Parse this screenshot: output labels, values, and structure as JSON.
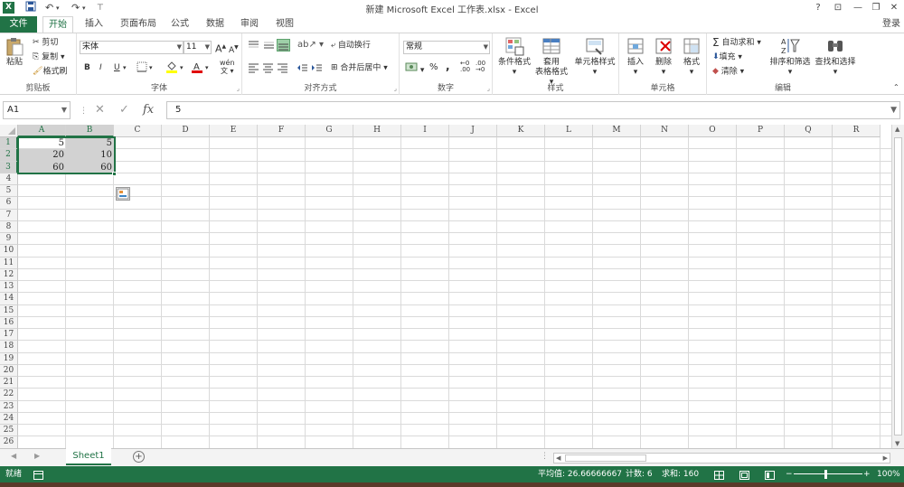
{
  "window": {
    "title": "新建 Microsoft Excel 工作表.xlsx - Excel",
    "help": "?",
    "restore_ribbon": "⊡",
    "minimize": "—",
    "maximize": "❐",
    "close": "✕"
  },
  "qat": {
    "undo": "↶",
    "redo": "↷",
    "more": "⊤"
  },
  "tabs": [
    {
      "label": "文件"
    },
    {
      "label": "开始"
    },
    {
      "label": "插入"
    },
    {
      "label": "页面布局"
    },
    {
      "label": "公式"
    },
    {
      "label": "数据"
    },
    {
      "label": "审阅"
    },
    {
      "label": "视图"
    }
  ],
  "login": "登录",
  "ribbon": {
    "clipboard": {
      "paste": "粘贴",
      "cut": "剪切",
      "copy": "复制",
      "format_painter": "格式刷",
      "label": "剪贴板"
    },
    "font": {
      "name": "宋体",
      "size": "11",
      "grow": "A",
      "shrink": "A",
      "bold": "B",
      "italic": "I",
      "underline": "U",
      "label": "字体",
      "phonetic": "wén"
    },
    "alignment": {
      "wrap": "自动换行",
      "merge": "合并后居中",
      "label": "对齐方式"
    },
    "number": {
      "format": "常规",
      "percent": "%",
      "comma": ",",
      "label": "数字"
    },
    "styles": {
      "conditional": "条件格式",
      "table_line1": "套用",
      "table_line2": "表格格式",
      "cell_styles": "单元格样式",
      "label": "样式"
    },
    "cells": {
      "insert": "插入",
      "delete": "删除",
      "format": "格式",
      "label": "单元格"
    },
    "editing": {
      "autosum": "自动求和",
      "fill": "填充",
      "clear": "清除",
      "sort": "排序和筛选",
      "find": "查找和选择",
      "label": "编辑"
    }
  },
  "formula_bar": {
    "name_box": "A1",
    "formula": "5",
    "fx": "fx"
  },
  "columns": [
    "A",
    "B",
    "C",
    "D",
    "E",
    "F",
    "G",
    "H",
    "I",
    "J",
    "K",
    "L",
    "M",
    "N",
    "O",
    "P",
    "Q",
    "R"
  ],
  "rows": [
    "1",
    "2",
    "3",
    "4",
    "5",
    "6",
    "7",
    "8",
    "9",
    "10",
    "11",
    "12",
    "13",
    "14",
    "15",
    "16",
    "17",
    "18",
    "19",
    "20",
    "21",
    "22",
    "23",
    "24",
    "25",
    "26"
  ],
  "cells": {
    "A1": "5",
    "B1": "5",
    "A2": "20",
    "B2": "10",
    "A3": "60",
    "B3": "60"
  },
  "sheets": [
    {
      "name": "Sheet1"
    }
  ],
  "status": {
    "mode": "就绪",
    "average": "平均值: 26.66666667",
    "count": "计数: 6",
    "sum": "求和: 160",
    "zoom": "100%",
    "zoom_minus": "−",
    "zoom_plus": "+"
  },
  "colors": {
    "accent": "#217346",
    "selection": "#d2d2d2"
  }
}
